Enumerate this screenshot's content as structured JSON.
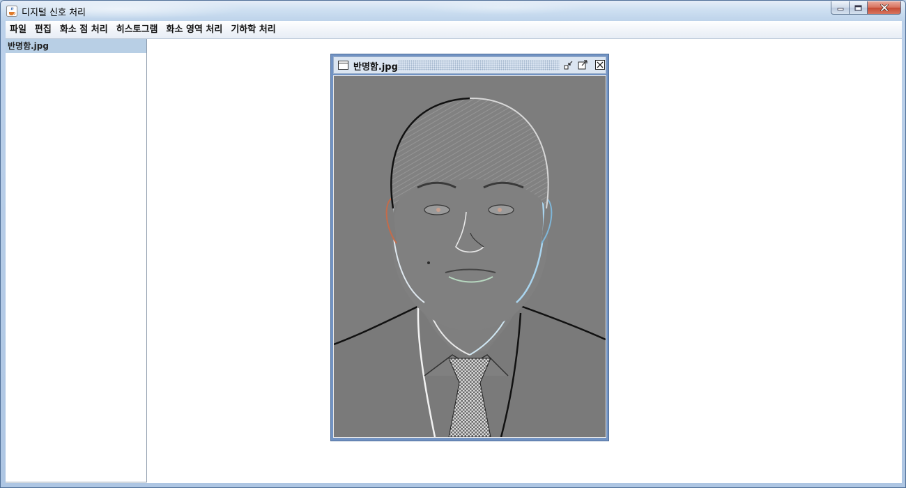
{
  "window": {
    "title": "디지털 신호 처리",
    "app_icon": "java-cup-icon",
    "controls": {
      "minimize_icon": "minimize-icon",
      "maximize_icon": "maximize-icon",
      "close_icon": "close-icon"
    }
  },
  "menubar": {
    "items": [
      {
        "label": "파일"
      },
      {
        "label": "편집"
      },
      {
        "label": "화소 점 처리"
      },
      {
        "label": "히스토그램"
      },
      {
        "label": "화소 영역 처리"
      },
      {
        "label": "기하학 처리"
      }
    ]
  },
  "sidebar": {
    "items": [
      {
        "label": "반명함.jpg",
        "selected": true
      }
    ]
  },
  "internal_frame": {
    "title": "반명함.jpg",
    "icon": "window-icon",
    "buttons": [
      "iconify-icon",
      "restore-icon",
      "close-icon"
    ],
    "image_effect": "emboss"
  },
  "colors": {
    "title_bar": "#c4d7ec",
    "frame_border": "#7293c3",
    "selection": "#b8cfe5",
    "emboss_gray": "#7c7c7c",
    "close_red": "#c54a33"
  }
}
